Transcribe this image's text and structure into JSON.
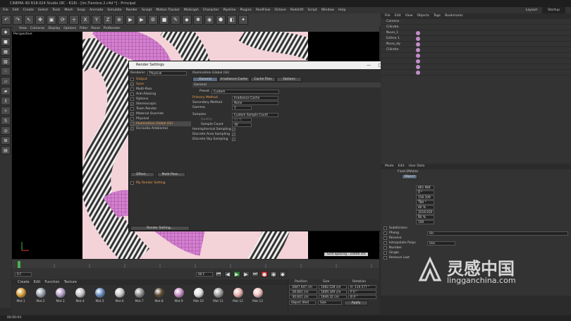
{
  "window": {
    "title": "CINEMA 4D R18.024 Studio (RC - R18) - [Im.Tiembra 2.c4d *] - Principal"
  },
  "menu": [
    "File",
    "Edit",
    "Create",
    "Select",
    "Tools",
    "Mesh",
    "Snap",
    "Animate",
    "Simulate",
    "Render",
    "Sculpt",
    "Motion Tracker",
    "MoGraph",
    "Character",
    "Pipeline",
    "Plugins",
    "RealFlow",
    "Octane",
    "Redshift",
    "Script",
    "Window",
    "Help"
  ],
  "layout_label": "Layout:",
  "layout_value": "Startup",
  "viewport": {
    "menu": [
      "View",
      "Cameras",
      "Display",
      "Options",
      "Filter",
      "Panel",
      "ProRender"
    ],
    "label": "Perspective",
    "grid_spacing": "Grid Spacing : 10000 cm"
  },
  "dialog": {
    "title": "Render Settings",
    "renderer_label": "Renderer",
    "renderer_value": "Physical",
    "sections": [
      {
        "label": "Output",
        "checked": false,
        "active": false,
        "highlight": true
      },
      {
        "label": "Save",
        "checked": true,
        "active": false,
        "highlight": true
      },
      {
        "label": "Multi-Pass",
        "checked": false,
        "active": false,
        "highlight": false
      },
      {
        "label": "Anti-Aliasing",
        "checked": false,
        "active": false,
        "highlight": false
      },
      {
        "label": "Options",
        "checked": false,
        "active": false,
        "highlight": false
      },
      {
        "label": "Stereoscopic",
        "checked": true,
        "active": false,
        "highlight": false
      },
      {
        "label": "Team Render",
        "checked": false,
        "active": false,
        "highlight": false
      },
      {
        "label": "Material Override",
        "checked": true,
        "active": false,
        "highlight": false
      },
      {
        "label": "Physical",
        "checked": false,
        "active": false,
        "highlight": false
      },
      {
        "label": "Illumination Global (GI)",
        "checked": true,
        "active": true,
        "highlight": true
      },
      {
        "label": "Occlusão Ambiental",
        "checked": true,
        "active": false,
        "highlight": false
      }
    ],
    "effect_button": "Effect...",
    "multipass_button": "Multi-Pass...",
    "my_render_setting": "My Render Setting",
    "render_setting_button": "Render Setting...",
    "panel_title": "Illumination Global (GI)",
    "tabs": [
      "General",
      "Irradiance Cache",
      "Cache Files",
      "Options"
    ],
    "group_label": "General",
    "preset_label": "Preset",
    "preset_value": "Custom",
    "primary_method_label": "Primary Method",
    "primary_method_value": "Irradiance Cache",
    "secondary_method_label": "Secondary Method",
    "secondary_method_value": "None",
    "gamma_label": "Gamma",
    "gamma_value": "1",
    "samples_label": "Samples",
    "samples_value": "Custom Sample Count",
    "quality_label": "Quality",
    "quality_value": "83 %",
    "sample_count_label": "Sample Count",
    "sample_count_value": "30",
    "hemispherical_label": "Hemispherical Sampling",
    "discrete_area_label": "Discrete Area Sampling",
    "discrete_sky_label": "Discrete Sky Sampling"
  },
  "objects": {
    "tabs": [
      "File",
      "Edit",
      "View",
      "Objects",
      "Tags",
      "Bookmarks"
    ],
    "rows": [
      "Camera",
      "Cilindro",
      "Nuvo_1",
      "Esfera 1",
      "Nuvo_dy",
      "Cilindro",
      "",
      "",
      "",
      ""
    ]
  },
  "attributes": {
    "tabs": [
      "Mode",
      "Edit",
      "User Data"
    ],
    "title": "Fluid (Média)",
    "object_tab": "Object",
    "values": [
      "861.984 m",
      "0 °",
      "156.109 m",
      "780 °",
      "80 %",
      "3516.935 °",
      "80 %",
      "100"
    ],
    "sections": [
      "Subdivision",
      "Phong",
      "Receive",
      "Interpolate Polys",
      "Number",
      "Single",
      "Remove Last"
    ],
    "phong_value": "On",
    "interp_value": "Use"
  },
  "timeline": {
    "start": "0 F",
    "end": "90 F",
    "current": "0 F"
  },
  "materials": {
    "menu": [
      "Create",
      "Edit",
      "Function",
      "Texture"
    ],
    "items": [
      {
        "name": "Mat.1",
        "color": "#d7a13a"
      },
      {
        "name": "Mat.2",
        "color": "#9aa3ad"
      },
      {
        "name": "Mat.3",
        "color": "#b7a2c7"
      },
      {
        "name": "Mat.4",
        "color": "#c5c5c5"
      },
      {
        "name": "Mat.5",
        "color": "#6b8fc2"
      },
      {
        "name": "Mat.6",
        "color": "#c8c8c8"
      },
      {
        "name": "Mat.7",
        "color": "#8f8f8f"
      },
      {
        "name": "Mat.8",
        "color": "#5f4d35"
      },
      {
        "name": "Mat.9",
        "color": "#c98fc7"
      },
      {
        "name": "Mat.10",
        "color": "#e0e0e0"
      },
      {
        "name": "Mat.11",
        "color": "#a0a0a0"
      },
      {
        "name": "Mat.12",
        "color": "#e8b0b0"
      },
      {
        "name": "Mat.13",
        "color": "#f0c0c0"
      }
    ]
  },
  "coordinates": {
    "headers": [
      "Position",
      "Size",
      "Rotation"
    ],
    "rows": [
      [
        "-2847.647 cm",
        "1682.528 cm",
        "H -110.577 °"
      ],
      [
        "-28.681 cm",
        "1609.349 cm",
        "P 0 °"
      ],
      [
        "-30.641 cm",
        "1949.32 cm",
        "B 0 °"
      ]
    ],
    "mode": "Object (Rel)",
    "size": "Size",
    "apply": "Apply"
  },
  "status": "00:00:04",
  "watermark": {
    "text": "灵感中国",
    "url": "lingganchina.com"
  }
}
